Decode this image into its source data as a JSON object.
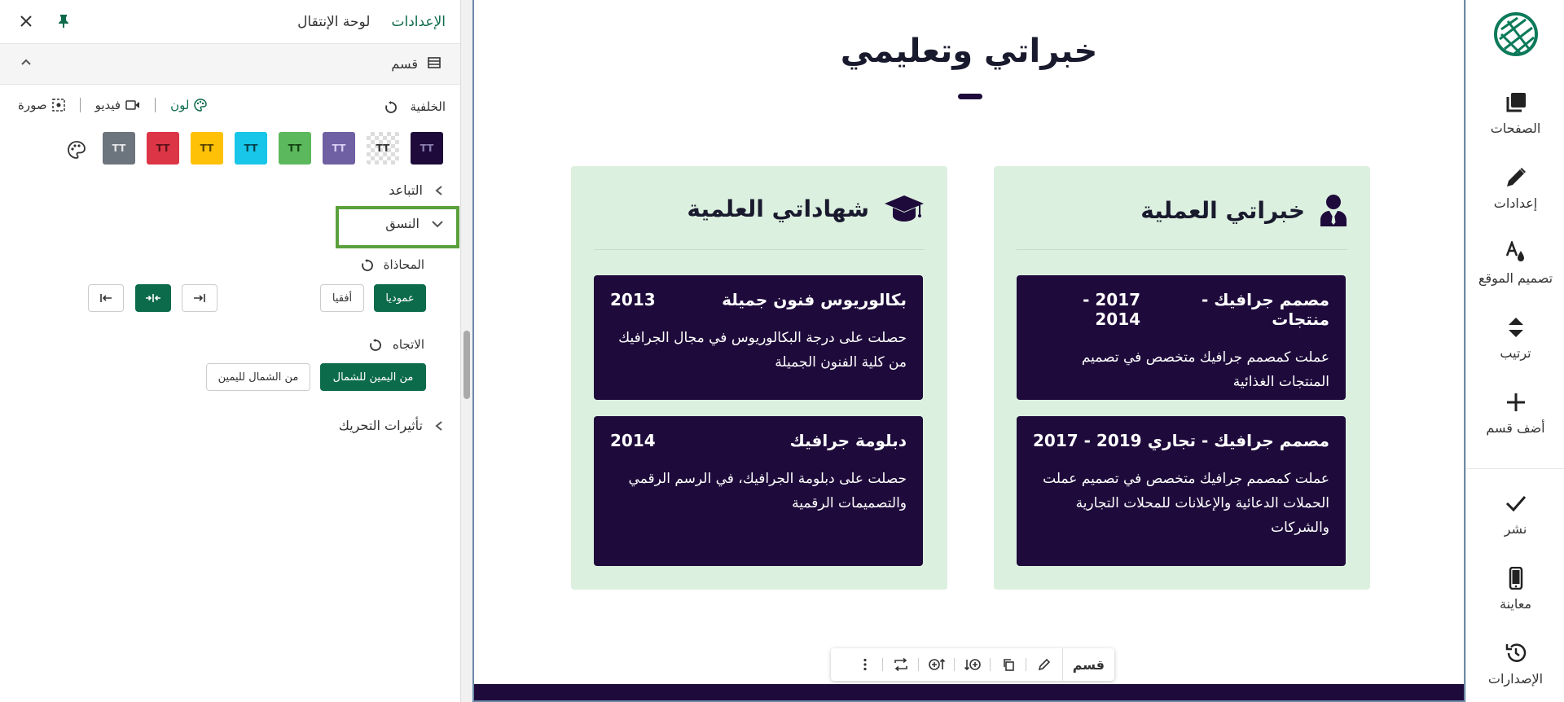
{
  "panel": {
    "tab_settings": "الإعدادات",
    "tab_navigator": "لوحة الإنتقال",
    "section_title": "قسم",
    "background_label": "الخلفية",
    "bg_types": {
      "color": "لون",
      "video": "فيديو",
      "image": "صورة"
    },
    "swatches": [
      {
        "color": "#1e0b3b",
        "text_color": "#8a7fb0"
      },
      {
        "color": "checker",
        "text_color": "#333"
      },
      {
        "color": "#6f5fa3",
        "text_color": "#d9d0f5"
      },
      {
        "color": "#5cb85c",
        "text_color": "#114411"
      },
      {
        "color": "#17c6e8",
        "text_color": "#06424e"
      },
      {
        "color": "#ffc107",
        "text_color": "#5a4300"
      },
      {
        "color": "#dc3545",
        "text_color": "#5a1018"
      },
      {
        "color": "#6c757d",
        "text_color": "#e4e6e8"
      }
    ],
    "swatch_glyph": "TT",
    "spacing_label": "التباعد",
    "layout_label": "النسق",
    "alignment_label": "المحاذاة",
    "vertical_button": "عموديا",
    "horizontal_button": "أفقيا",
    "direction_label": "الاتجاه",
    "rtl_button": "من اليمين للشمال",
    "ltr_button": "من الشمال لليمين",
    "animation_label": "تأثيرات التحريك"
  },
  "canvas": {
    "title": "خبراتي وتعليمي",
    "experience": {
      "heading": "خبراتي العملية",
      "items": [
        {
          "title": "مصمم جرافيك - منتجات",
          "years": "2017 - 2014",
          "desc": "عملت كمصمم جرافيك متخصص في تصميم المنتجات الغذائية"
        },
        {
          "title": "مصمم جرافيك - تجاري",
          "years": "2019 - 2017",
          "desc": "عملت كمصمم جرافيك متخصص في تصميم عملت الحملات الدعائية والإعلانات للمحلات التجارية والشركات"
        }
      ]
    },
    "education": {
      "heading": "شهاداتي العلمية",
      "items": [
        {
          "title": "بكالوريوس فنون جميلة",
          "years": "2013",
          "desc": "حصلت على درجة البكالوريوس في مجال الجرافيك من كلية الفنون الجميلة"
        },
        {
          "title": "دبلومة جرافيك",
          "years": "2014",
          "desc": "حصلت على دبلومة الجرافيك، في الرسم الرقمي والتصميمات الرقمية"
        }
      ]
    },
    "toolbar_label": "قسم"
  },
  "rail": {
    "pages": "الصفحات",
    "settings": "إعدادات",
    "design": "تصميم الموقع",
    "arrange": "ترتيب",
    "add_section": "أضف قسم",
    "publish": "نشر",
    "preview": "معاينة",
    "versions": "الإصدارات"
  },
  "colors": {
    "accent": "#0c6b4a",
    "card": "#1e0b3b",
    "column_bg": "#dcf0df",
    "highlight": "#5aa03c"
  }
}
